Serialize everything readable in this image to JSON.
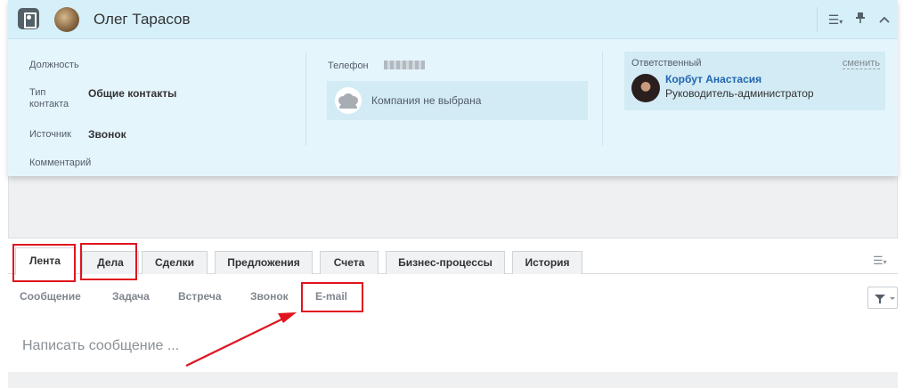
{
  "contact": {
    "name": "Олег Тарасов",
    "fields": {
      "position_label": "Должность",
      "type_label": "Тип\nконтакта",
      "type_value": "Общие контакты",
      "source_label": "Источник",
      "source_value": "Звонок",
      "comment_label": "Комментарий",
      "phone_label": "Телефон",
      "company_text": "Компания не выбрана"
    },
    "responsible": {
      "label": "Ответственный",
      "change_link": "сменить",
      "name": "Корбут Анастасия",
      "role": "Руководитель-администратор"
    }
  },
  "header_icons": {
    "contact": "contact-card-icon",
    "list": "list-settings-icon",
    "pin": "pin-icon",
    "collapse": "chevron-up-icon"
  },
  "tabs": [
    {
      "label": "Лента",
      "active": true
    },
    {
      "label": "Дела",
      "active": false
    },
    {
      "label": "Сделки",
      "active": false
    },
    {
      "label": "Предложения",
      "active": false
    },
    {
      "label": "Счета",
      "active": false
    },
    {
      "label": "Бизнес-процессы",
      "active": false
    },
    {
      "label": "История",
      "active": false
    }
  ],
  "activity_types": [
    "Сообщение",
    "Задача",
    "Встреча",
    "Звонок",
    "E-mail"
  ],
  "compose_placeholder": "Написать сообщение ...",
  "colors": {
    "header_bg": "#d6f0fa",
    "card_bg": "#e5f5fc",
    "link_blue": "#2067b0",
    "annotation_red": "#e0141e"
  }
}
